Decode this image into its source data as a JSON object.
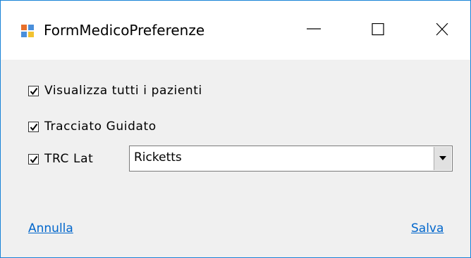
{
  "window": {
    "title": "FormMedicoPreferenze",
    "app_icon": "winforms-app-icon",
    "controls": {
      "minimize_icon": "minimize-icon",
      "maximize_icon": "maximize-icon",
      "close_icon": "close-icon"
    }
  },
  "options": [
    {
      "label": "Visualizza tutti i pazienti",
      "checked": true
    },
    {
      "label": "Tracciato Guidato",
      "checked": true
    },
    {
      "label": "TRC Lat",
      "checked": true
    }
  ],
  "trc_lat_combo": {
    "selected": "Ricketts"
  },
  "links": {
    "cancel": "Annulla",
    "save": "Salva"
  },
  "colors": {
    "link": "#0066cc",
    "window_border": "#1883d7",
    "client_bg": "#f0f0f0"
  }
}
